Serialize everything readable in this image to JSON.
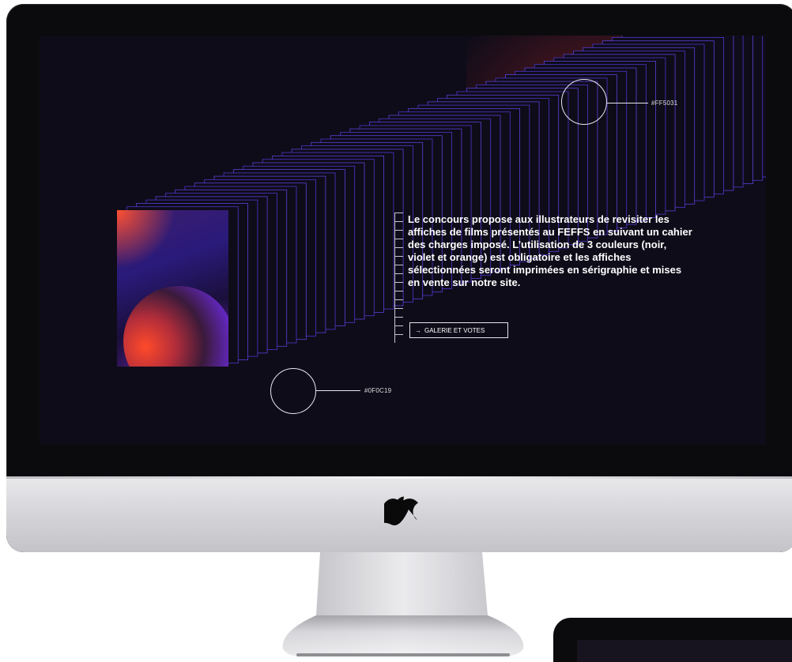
{
  "screen": {
    "background_color": "#0F0C19",
    "accent_orange": "#FF5031",
    "accent_violet": "#6A25D8"
  },
  "swatches": {
    "orange_label": "#FF5031",
    "dark_label": "#0F0C19"
  },
  "content": {
    "description": "Le concours propose aux illustrateurs de revisiter les affiches de films présentés au FEFFS en suivant un cahier des charges imposé. L’utilisation de 3 couleurs (noir, violet et orange) est obligatoire et les affiches sélectionnées seront imprimées en sérigraphie et mises en vente sur notre site.",
    "cta_arrow": "→",
    "cta_label": "GALERIE ET VOTES"
  },
  "icons": {
    "brand": "apple-logo-icon"
  }
}
